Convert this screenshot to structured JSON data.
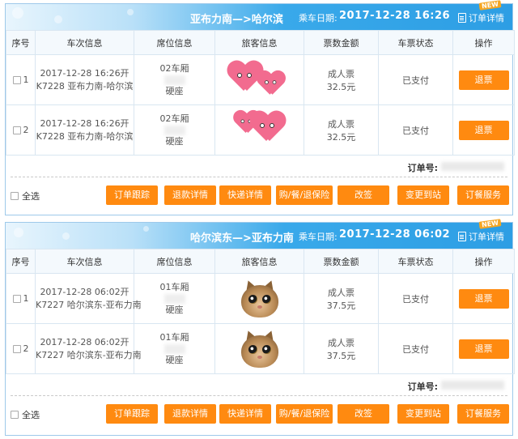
{
  "orders": [
    {
      "route": "亚布力南—>哈尔滨",
      "date_label": "乘车日期:",
      "date_value": "2017-12-28 16:26",
      "detail_label": "订单详情",
      "new_badge": "NEW",
      "headers": [
        "序号",
        "车次信息",
        "席位信息",
        "旅客信息",
        "票数金额",
        "车票状态",
        "操作"
      ],
      "rows": [
        {
          "seq": "1",
          "train_time": "2017-12-28 16:26开",
          "train_route": "K7228 亚布力南-哈尔滨",
          "car": "02车厢",
          "seat_type": "硬座",
          "passenger_avatar": "pink-heart-sticker",
          "ticket_type": "成人票",
          "price": "32.5元",
          "status": "已支付",
          "action": "退票"
        },
        {
          "seq": "2",
          "train_time": "2017-12-28 16:26开",
          "train_route": "K7228 亚布力南-哈尔滨",
          "car": "02车厢",
          "seat_type": "硬座",
          "passenger_avatar": "pink-heart-sticker",
          "ticket_type": "成人票",
          "price": "32.5元",
          "status": "已支付",
          "action": "退票"
        }
      ],
      "order_no_label": "订单号:",
      "select_all": "全选",
      "buttons": [
        "订单跟踪",
        "退款详情",
        "快递详情",
        "购/餐/退保险",
        "改签",
        "变更到站",
        "订餐服务"
      ]
    },
    {
      "route": "哈尔滨东—>亚布力南",
      "date_label": "乘车日期:",
      "date_value": "2017-12-28 06:02",
      "detail_label": "订单详情",
      "new_badge": "NEW",
      "headers": [
        "序号",
        "车次信息",
        "席位信息",
        "旅客信息",
        "票数金额",
        "车票状态",
        "操作"
      ],
      "rows": [
        {
          "seq": "1",
          "train_time": "2017-12-28 06:02开",
          "train_route": "K7227 哈尔滨东-亚布力南",
          "car": "01车厢",
          "seat_type": "硬座",
          "passenger_avatar": "cat-face-photo",
          "ticket_type": "成人票",
          "price": "37.5元",
          "status": "已支付",
          "action": "退票"
        },
        {
          "seq": "2",
          "train_time": "2017-12-28 06:02开",
          "train_route": "K7227 哈尔滨东-亚布力南",
          "car": "01车厢",
          "seat_type": "硬座",
          "passenger_avatar": "cat-face-photo",
          "ticket_type": "成人票",
          "price": "37.5元",
          "status": "已支付",
          "action": "退票"
        }
      ],
      "order_no_label": "订单号:",
      "select_all": "全选",
      "buttons": [
        "订单跟踪",
        "退款详情",
        "快递详情",
        "购/餐/退保险",
        "改签",
        "变更到站",
        "订餐服务"
      ]
    }
  ],
  "icons": {
    "detail": "document-icon",
    "checkbox": "checkbox-icon"
  },
  "colors": {
    "header_blue": "#2d9ee4",
    "button_orange": "#ff8a10",
    "border": "#9ec9ea"
  }
}
